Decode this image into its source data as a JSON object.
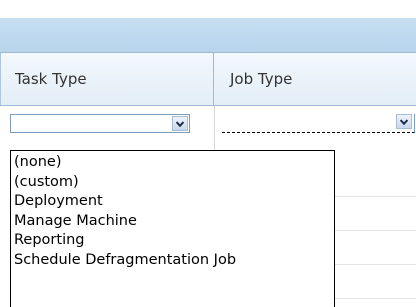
{
  "grid": {
    "columns": [
      {
        "label": "Task Type"
      },
      {
        "label": "Job Type"
      }
    ]
  },
  "filters": {
    "task_type_value": "",
    "job_type_value": ""
  },
  "dropdown": {
    "options": [
      "(none)",
      "(custom)",
      "Deployment",
      "Manage Machine",
      "Reporting",
      "Schedule Defragmentation Job"
    ]
  }
}
